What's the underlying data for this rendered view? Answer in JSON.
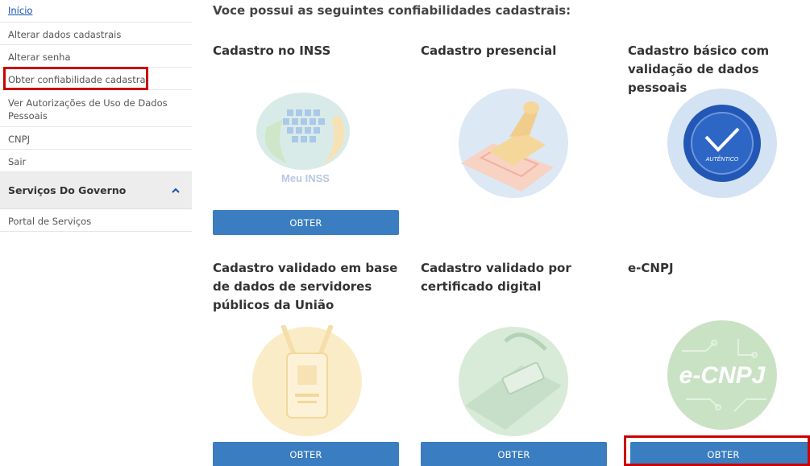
{
  "sidebar": {
    "items": [
      {
        "label": "Início"
      },
      {
        "label": "Alterar dados cadastrais"
      },
      {
        "label": "Alterar senha"
      },
      {
        "label": "Obter confiabilidade cadastral"
      },
      {
        "label": "Ver Autorizações de Uso de Dados Pessoais"
      },
      {
        "label": "CNPJ"
      },
      {
        "label": "Sair"
      }
    ],
    "section": {
      "title": "Serviços Do Governo",
      "items": [
        {
          "label": "Portal de Serviços"
        }
      ]
    }
  },
  "main": {
    "title": "Voce possui as seguintes confiabilidades cadastrais:",
    "cards": [
      {
        "title": "Cadastro no INSS",
        "image_text": "Meu INSS",
        "button": "OBTER"
      },
      {
        "title": "Cadastro presencial"
      },
      {
        "title": "Cadastro básico com validação de dados pessoais",
        "image_text": "AUTÊNTICO"
      },
      {
        "title": "Cadastro validado em base de dados de servidores públicos da União",
        "button": "OBTER"
      },
      {
        "title": "Cadastro validado por certificado digital",
        "button": "OBTER"
      },
      {
        "title": "e-CNPJ",
        "image_text": "e-CNPJ",
        "button": "OBTER"
      }
    ]
  },
  "colors": {
    "button": "#3a7dc0",
    "link": "#1351b4",
    "highlight": "#cc0000"
  }
}
